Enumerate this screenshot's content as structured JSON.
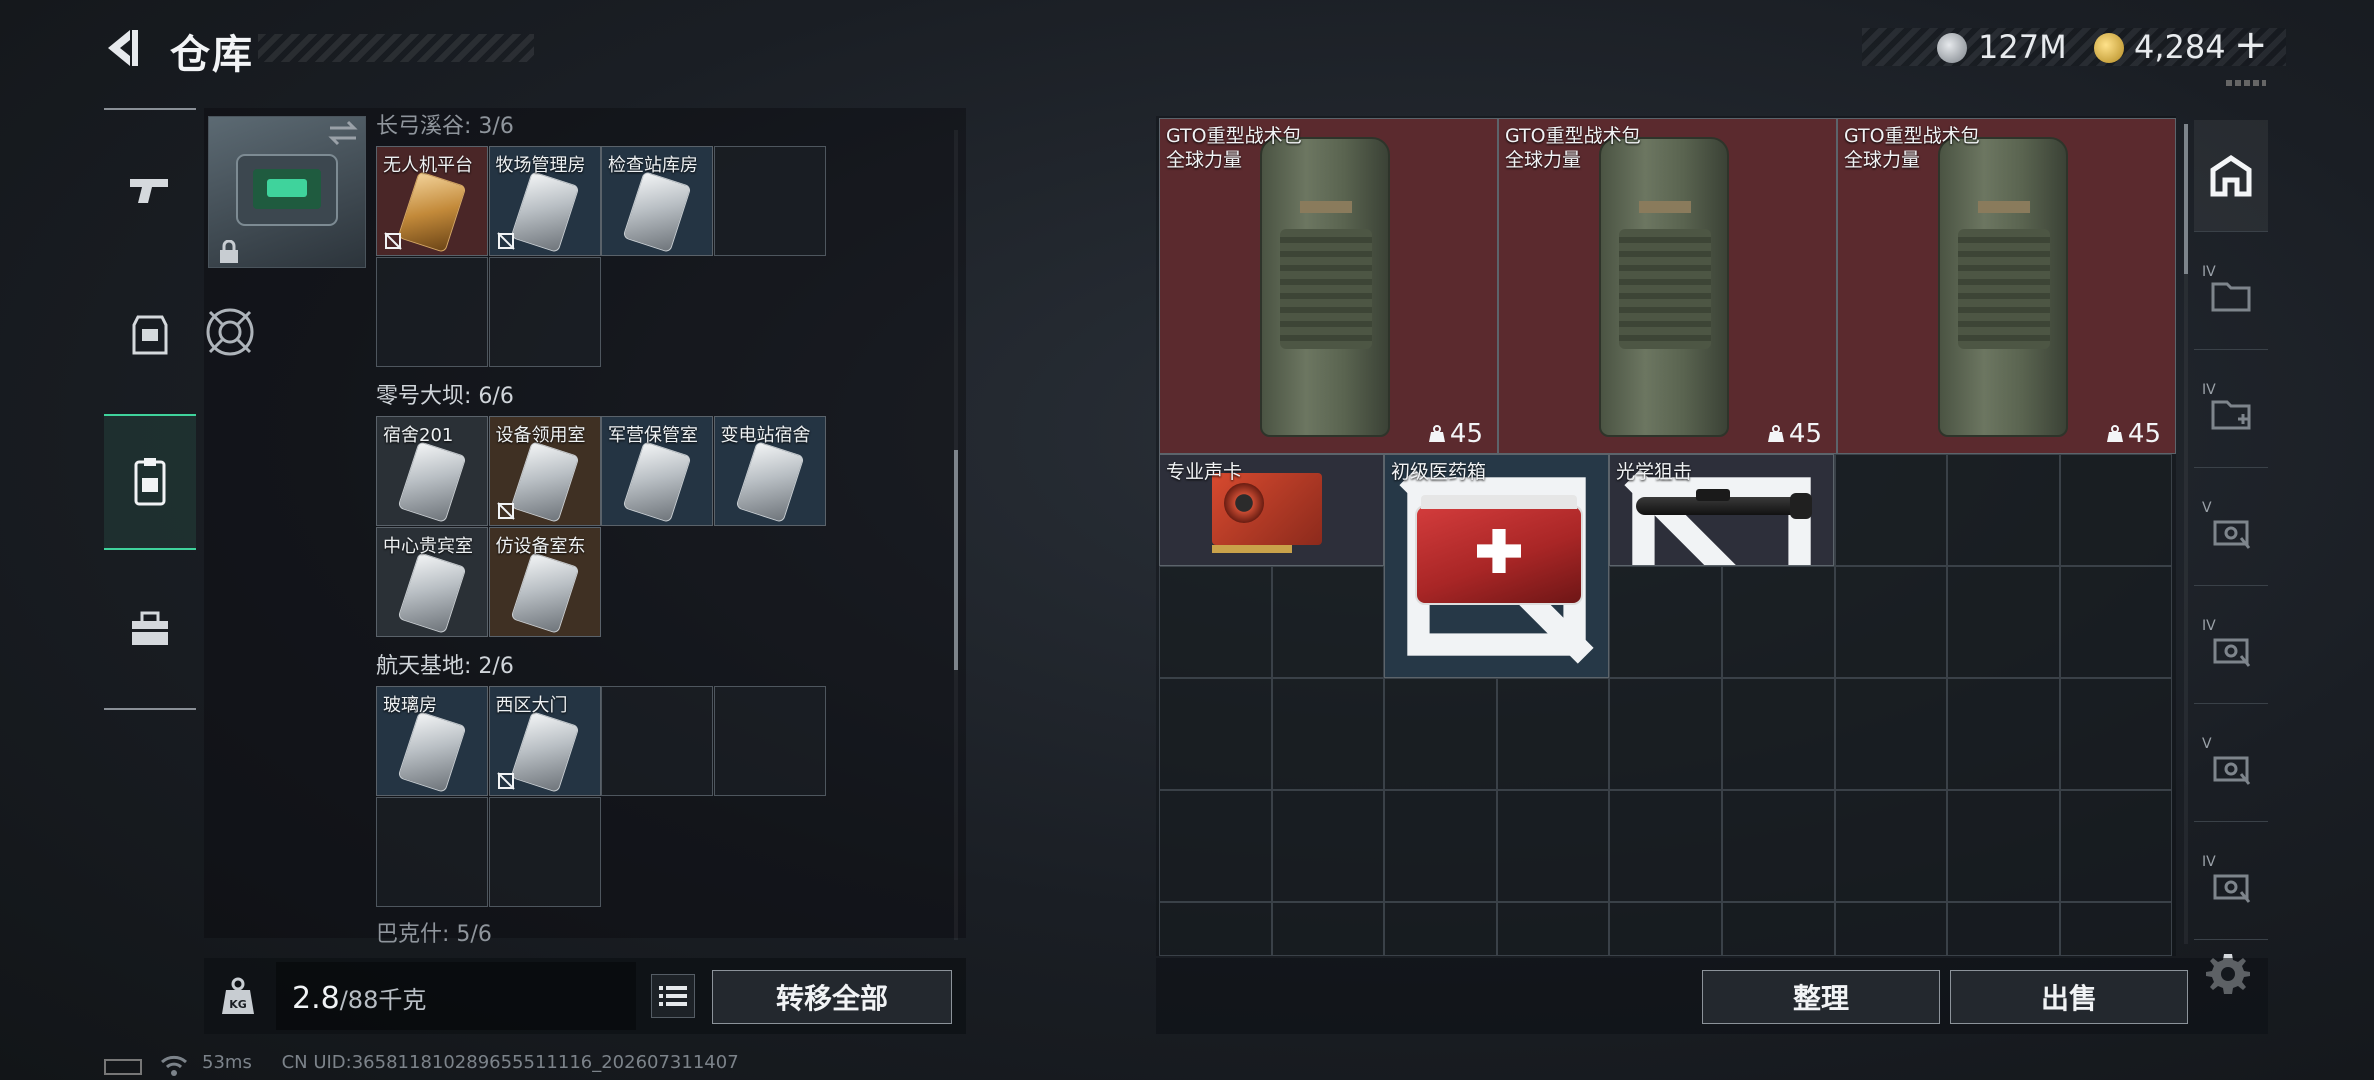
{
  "header": {
    "title": "仓库",
    "currency_silver": "127M",
    "currency_gold": "4,284",
    "currency_add": "+"
  },
  "key_sections": [
    {
      "label": "长弓溪谷: 3/6",
      "cards": [
        {
          "name": "无人机平台",
          "style": "red",
          "gold": true,
          "bound": true
        },
        {
          "name": "牧场管理房",
          "style": "blue",
          "gold": false,
          "bound": true
        },
        {
          "name": "检查站库房",
          "style": "blue",
          "gold": false,
          "bound": false
        }
      ]
    },
    {
      "label": "零号大坝: 6/6",
      "cards": [
        {
          "name": "宿舍201",
          "style": "gray",
          "bound": false
        },
        {
          "name": "设备领用室",
          "style": "brown",
          "bound": true
        },
        {
          "name": "军营保管室",
          "style": "blue",
          "bound": false
        },
        {
          "name": "变电站宿舍",
          "style": "blue",
          "bound": false
        },
        {
          "name": "中心贵宾室",
          "style": "gray",
          "bound": false
        },
        {
          "name": "仿设备室东",
          "style": "brown",
          "bound": false
        }
      ]
    },
    {
      "label": "航天基地: 2/6",
      "cards": [
        {
          "name": "玻璃房",
          "style": "blue",
          "bound": false
        },
        {
          "name": "西区大门",
          "style": "blue",
          "bound": true
        }
      ]
    },
    {
      "label": "巴克什: 5/6",
      "cards": []
    }
  ],
  "weight": {
    "current": "2.8",
    "max": "/88千克",
    "unit_icon": "KG"
  },
  "buttons": {
    "transfer_all": "转移全部",
    "organize": "整理",
    "sell": "出售"
  },
  "stash_items": [
    {
      "kind": "pack",
      "name": "GTO重型战术包",
      "sub": "全球力量",
      "weight": "45"
    },
    {
      "kind": "pack",
      "name": "GTO重型战术包",
      "sub": "全球力量",
      "weight": "45"
    },
    {
      "kind": "pack",
      "name": "GTO重型战术包",
      "sub": "全球力量",
      "weight": "45"
    },
    {
      "kind": "gpu",
      "name": "专业声卡"
    },
    {
      "kind": "medkit",
      "name": "初级医药箱"
    },
    {
      "kind": "scope",
      "name": "光学狙击"
    }
  ],
  "side_tabs": [
    {
      "icon": "stash-home-icon",
      "lvl": ""
    },
    {
      "icon": "folder-icon",
      "lvl": "IV"
    },
    {
      "icon": "add-folder-icon",
      "lvl": "IV"
    },
    {
      "icon": "expansion-box-icon",
      "lvl": "V"
    },
    {
      "icon": "expansion-box-icon",
      "lvl": "IV"
    },
    {
      "icon": "expansion-box-icon",
      "lvl": "V"
    },
    {
      "icon": "expansion-box-icon",
      "lvl": "IV"
    }
  ],
  "status": {
    "ping": "53ms",
    "uid": "CN UID:365811810289655511116_202607311407"
  },
  "colors": {
    "accent_green": "#3fd39c",
    "pack_bg": "#5b2a2e"
  }
}
